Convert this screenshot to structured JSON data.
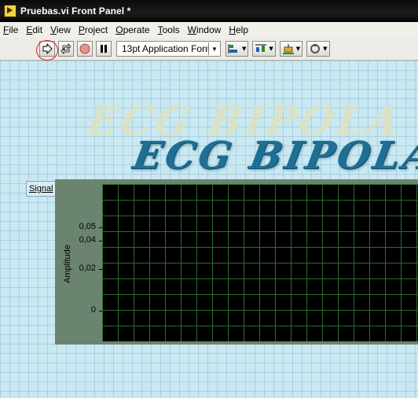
{
  "window": {
    "title": "Pruebas.vi Front Panel *"
  },
  "menu": [
    {
      "mnem": "F",
      "rest": "ile"
    },
    {
      "mnem": "E",
      "rest": "dit"
    },
    {
      "mnem": "V",
      "rest": "iew"
    },
    {
      "mnem": "P",
      "rest": "roject"
    },
    {
      "mnem": "O",
      "rest": "perate"
    },
    {
      "mnem": "T",
      "rest": "ools"
    },
    {
      "mnem": "W",
      "rest": "indow"
    },
    {
      "mnem": "H",
      "rest": "elp"
    }
  ],
  "toolbar": {
    "font_select": "13pt Application Font",
    "buttons": [
      "run-arrow-icon",
      "run-continuously-icon",
      "abort-icon",
      "pause-icon"
    ],
    "dropdowns": [
      "align-objects-icon",
      "distribute-objects-icon",
      "resize-objects-icon",
      "reorder-icon"
    ],
    "highlight_color": "#d42020"
  },
  "canvas": {
    "title_shadow": "ECG BIPOLA",
    "title_main": "ECG BIPOLA",
    "title_color": "#1f6f95",
    "background": "#c9e8f2"
  },
  "graph": {
    "label": "Signal",
    "y_axis_title": "Amplitude",
    "y_ticks": [
      "0,05",
      "0,04",
      "0,02",
      "0"
    ],
    "plot_bg": "#000000",
    "grid_color": "#2d6b2d"
  }
}
